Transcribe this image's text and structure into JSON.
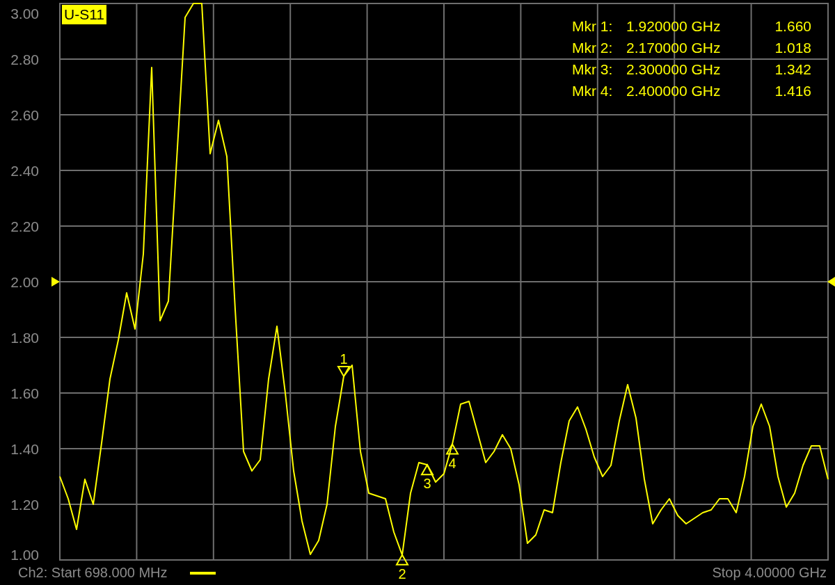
{
  "display": {
    "chart_data": {
      "type": "line",
      "ylim": [
        1.0,
        3.0
      ],
      "grid": true,
      "yticks": [
        {
          "value": 3,
          "label": "3.00"
        },
        {
          "value": 2.8,
          "label": "2.80"
        },
        {
          "value": 2.6,
          "label": "2.60"
        },
        {
          "value": 2.4,
          "label": "2.40"
        },
        {
          "value": 2.2,
          "label": "2.20"
        },
        {
          "value": 2,
          "label": "2.00"
        },
        {
          "value": 1.8,
          "label": "1.80"
        },
        {
          "value": 1.6,
          "label": "1.60"
        },
        {
          "value": 1.4,
          "label": "1.40"
        },
        {
          "value": 1.2,
          "label": "1.20"
        },
        {
          "value": 1,
          "label": "1.00"
        }
      ],
      "categories": [
        null,
        null,
        null,
        null,
        null,
        null,
        null,
        null,
        null,
        null,
        null,
        null,
        null,
        null,
        null,
        null,
        null,
        null,
        null,
        null,
        null,
        null,
        null,
        null,
        null,
        null,
        null,
        null,
        null,
        null,
        null,
        null,
        null,
        null,
        null,
        null,
        null,
        null,
        null,
        null,
        null,
        null,
        null,
        null,
        null,
        null,
        null,
        null,
        null,
        null,
        null,
        null,
        null,
        null,
        null,
        null,
        null,
        null,
        null,
        null,
        null,
        null,
        null,
        null,
        null,
        null,
        null,
        null,
        null,
        null,
        null,
        null,
        null,
        null,
        null,
        null,
        null,
        null,
        null,
        null,
        null,
        null,
        null,
        null,
        null,
        null,
        null,
        null,
        null,
        null,
        null,
        null,
        null
      ],
      "series": [
        {
          "name": "U-S11",
          "color": "#ffff00",
          "values": [
            1.3,
            1.22,
            1.11,
            1.29,
            1.2,
            1.42,
            1.65,
            1.79,
            1.96,
            1.83,
            2.1,
            2.77,
            1.86,
            1.93,
            2.44,
            2.95,
            3.0,
            3.0,
            2.46,
            2.58,
            2.45,
            1.9,
            1.39,
            1.32,
            1.36,
            1.65,
            1.84,
            1.6,
            1.32,
            1.14,
            1.02,
            1.07,
            1.2,
            1.48,
            1.66,
            1.7,
            1.39,
            1.24,
            1.23,
            1.22,
            1.1,
            1.018,
            1.24,
            1.35,
            1.342,
            1.28,
            1.31,
            1.416,
            1.56,
            1.57,
            1.46,
            1.35,
            1.39,
            1.45,
            1.4,
            1.27,
            1.06,
            1.09,
            1.18,
            1.17,
            1.35,
            1.5,
            1.55,
            1.47,
            1.37,
            1.3,
            1.34,
            1.5,
            1.63,
            1.51,
            1.29,
            1.13,
            1.18,
            1.22,
            1.16,
            1.13,
            1.15,
            1.17,
            1.18,
            1.22,
            1.22,
            1.17,
            1.3,
            1.48,
            1.56,
            1.48,
            1.3,
            1.19,
            1.24,
            1.34,
            1.41,
            1.41,
            1.29
          ]
        }
      ],
      "annotations": [
        {
          "text": "1",
          "y": 1.66
        },
        {
          "text": "2",
          "y": 1.018
        },
        {
          "text": "3",
          "y": 1.342
        },
        {
          "text": "4",
          "y": 1.416
        }
      ]
    },
    "readout": [
      {
        "name": "Mkr 1:",
        "frequency": "1.920000 GHz",
        "value": "1.660",
        "active": true
      },
      {
        "name": "Mkr 2:",
        "frequency": "2.170000 GHz",
        "value": "1.018",
        "active": false
      },
      {
        "name": "Mkr 3:",
        "frequency": "2.300000 GHz",
        "value": "1.342",
        "active": false
      },
      {
        "name": "Mkr 4:",
        "frequency": "2.400000 GHz",
        "value": "1.416",
        "active": false
      }
    ]
  },
  "status_bar": {
    "start": "Ch2: Start 698.000 MHz",
    "stop": "Stop 4.00000 GHz"
  }
}
